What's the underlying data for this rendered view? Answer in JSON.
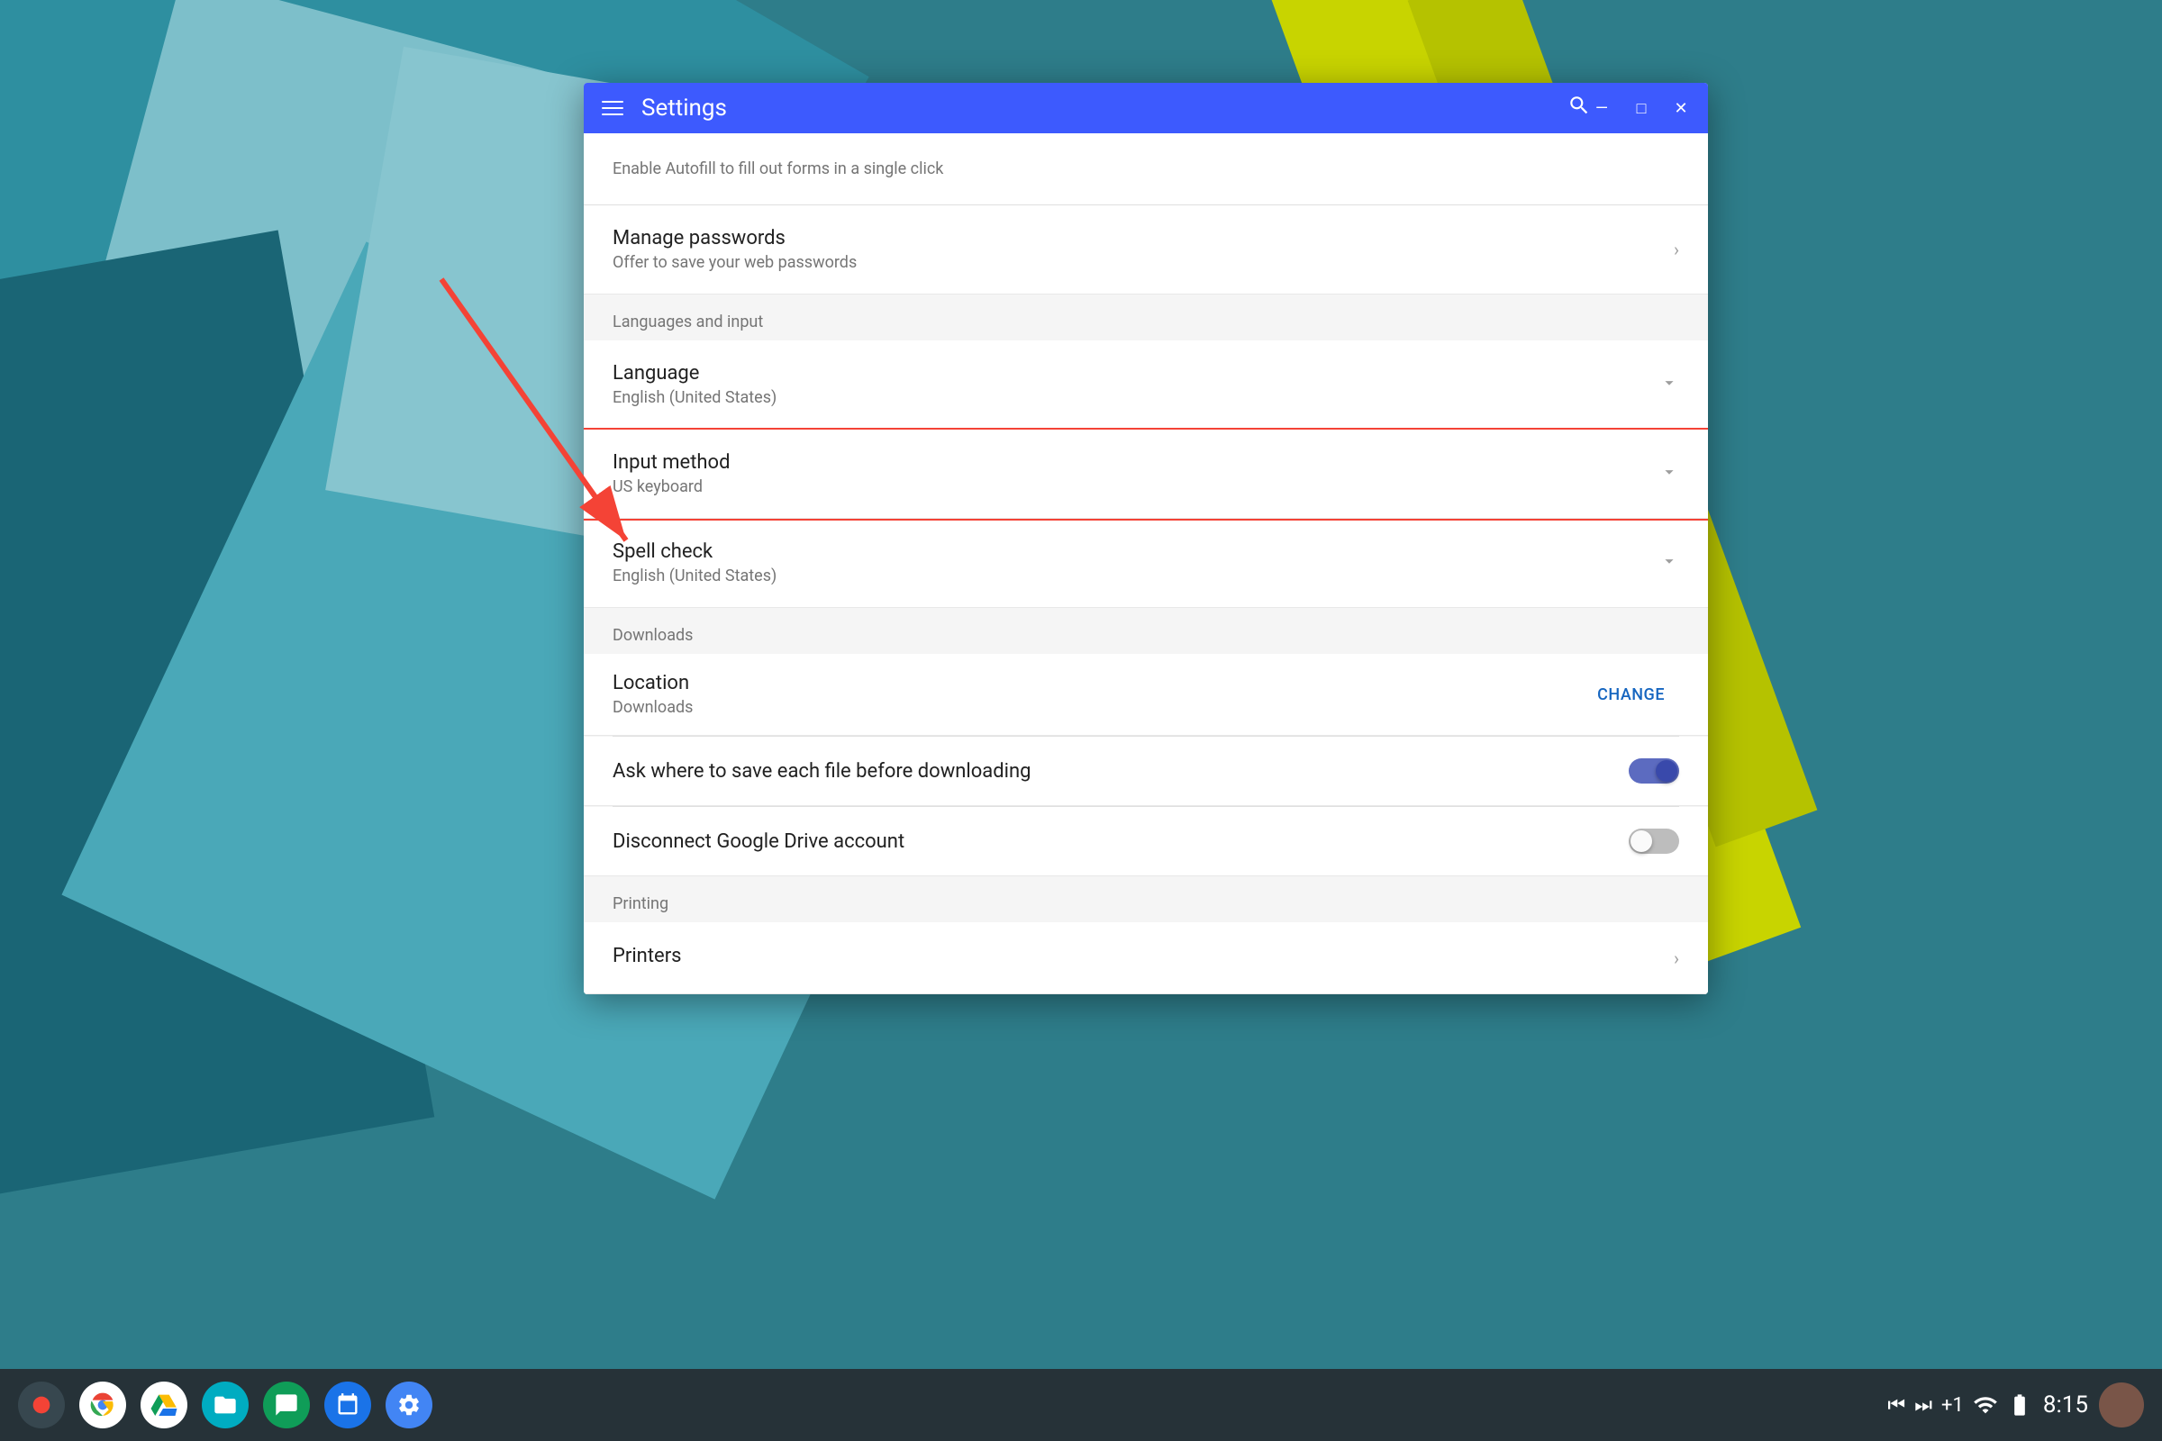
{
  "desktop": {
    "taskbar": {
      "time": "8:15",
      "apps": [
        {
          "name": "record",
          "icon": "⏺",
          "color": "#263238"
        },
        {
          "name": "chrome",
          "icon": "◉",
          "color": "#ffffff"
        },
        {
          "name": "drive",
          "icon": "▲",
          "color": "#fbbc04"
        },
        {
          "name": "files",
          "icon": "📁",
          "color": "#00bcd4"
        },
        {
          "name": "hangouts",
          "icon": "💬",
          "color": "#0f9d58"
        },
        {
          "name": "calendar",
          "icon": "📅",
          "color": "#1a73e8"
        },
        {
          "name": "settings",
          "icon": "⚙",
          "color": "#4285f4"
        }
      ],
      "tray": {
        "media_prev": "⏮",
        "media_play": "⏭",
        "plus_one": "+1",
        "wifi_icon": "▲",
        "battery": "▮"
      }
    }
  },
  "window": {
    "title": "Settings",
    "controls": {
      "minimize": "—",
      "maximize": "□",
      "close": "✕"
    }
  },
  "settings": {
    "autofill_hint": "Enable Autofill to fill out forms in a single click",
    "sections": {
      "passwords": {
        "title": "Manage passwords",
        "subtitle": "Offer to save your web passwords"
      },
      "languages_header": "Languages and input",
      "language": {
        "title": "Language",
        "subtitle": "English (United States)"
      },
      "input_method": {
        "title": "Input method",
        "subtitle": "US keyboard"
      },
      "spell_check": {
        "title": "Spell check",
        "subtitle": "English (United States)"
      },
      "downloads_header": "Downloads",
      "location": {
        "title": "Location",
        "subtitle": "Downloads",
        "change_button": "CHANGE"
      },
      "ask_save": {
        "label": "Ask where to save each file before downloading",
        "toggle_state": "on"
      },
      "disconnect_drive": {
        "label": "Disconnect Google Drive account",
        "toggle_state": "off"
      },
      "printing_header": "Printing",
      "printers": {
        "title": "Printers"
      }
    }
  }
}
